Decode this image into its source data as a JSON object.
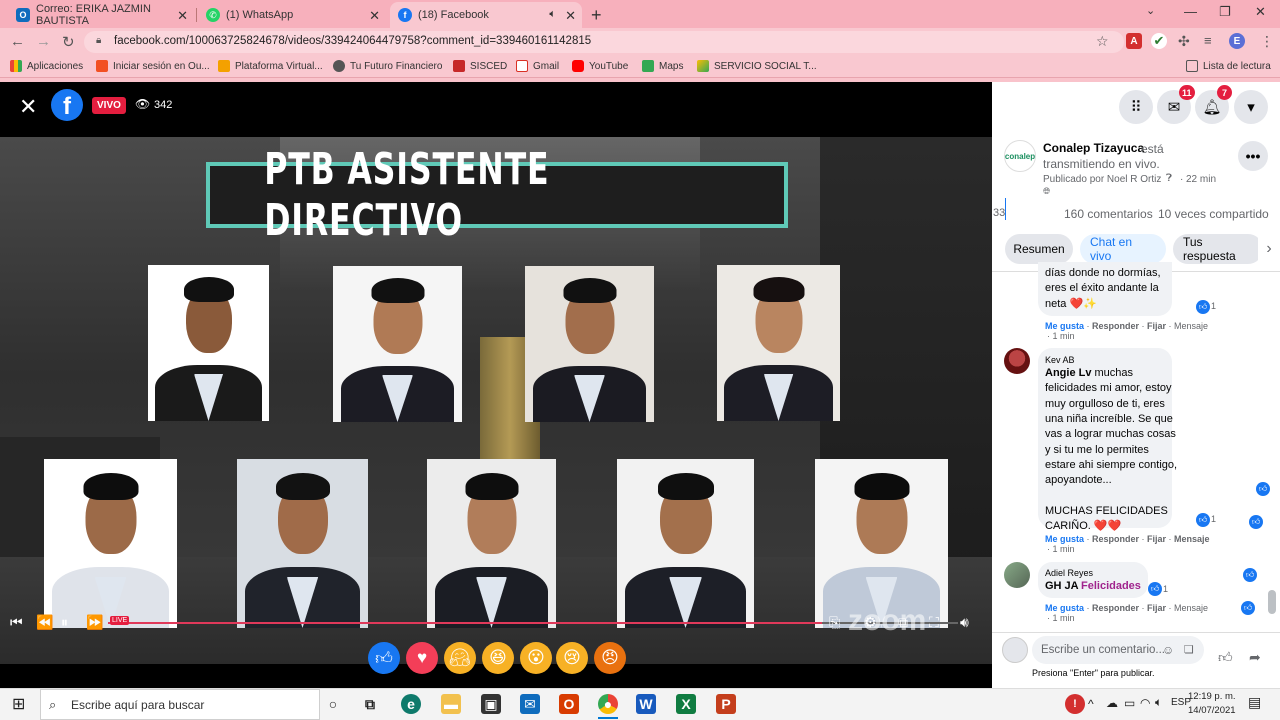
{
  "browser": {
    "tabs": [
      {
        "title": "Correo: ERIKA JAZMIN BAUTISTA",
        "icon": "outlook-icon"
      },
      {
        "title": "(1) WhatsApp",
        "icon": "whatsapp-icon"
      },
      {
        "title": "(18) Facebook",
        "icon": "facebook-icon",
        "active": true
      }
    ],
    "url": "facebook.com/100063725824678/videos/339424064479758?comment_id=339460161142815",
    "bookmarks": [
      "Aplicaciones",
      "Iniciar sesión en Ou...",
      "Plataforma Virtual...",
      "Tu Futuro Financiero",
      "SISCED",
      "Gmail",
      "YouTube",
      "Maps",
      "SERVICIO SOCIAL T..."
    ],
    "reading_list": "Lista de lectura",
    "profile_initial": "E"
  },
  "video": {
    "live_label": "VIVO",
    "viewers": "342",
    "title": "PTB ASISTENTE DIRECTIVO",
    "live_tag": "LIVE",
    "watermark": "zoom",
    "progress_fraction": 0.84
  },
  "reactions": [
    "like",
    "love",
    "care",
    "haha",
    "wow",
    "sad",
    "angry"
  ],
  "header": {
    "messenger_badge": "11",
    "notifications_badge": "7"
  },
  "post": {
    "page_name": "Conalep Tizayuca",
    "status": "está transmitiendo en vivo.",
    "status_line1": "está",
    "status_line2": "transmitiendo en vivo.",
    "published_by": "Publicado por Noel R Ortiz",
    "time": "22 min",
    "left_cut": "33",
    "comments_count": "160 comentarios",
    "shares_count": "10 veces compartido",
    "avatar_text": "conalep"
  },
  "tabs": [
    {
      "label": "Resumen"
    },
    {
      "label": "Chat en vivo",
      "selected": true
    },
    {
      "label": "Tus respuesta"
    }
  ],
  "comments": [
    {
      "author": "",
      "lines": [
        "días donde no dormías,",
        "eres el éxito andante la",
        "neta ❤️✨"
      ],
      "likes": "1",
      "actions": [
        "Me gusta",
        "Responder",
        "Fijar",
        "Mensaje"
      ],
      "time": "1 min"
    },
    {
      "author": "Kev AB",
      "lines": [
        "Angie Lv muchas",
        "felicidades mi amor, estoy",
        "muy orgulloso de ti, eres",
        "una niña increíble. Se que",
        "vas a lograr muchas cosas",
        "y si tu me lo permites",
        "estare ahi siempre contigo,",
        "apoyandote...",
        "",
        "MUCHAS FELICIDADES",
        "CARIÑO. ❤️❤️"
      ],
      "likes": "1",
      "actions": [
        "Me gusta",
        "Responder",
        "Fijar",
        "Mensaje"
      ],
      "time": "1 min"
    },
    {
      "author": "Adiel Reyes",
      "mention": "GH JA",
      "text": "Felicidades",
      "likes": "1",
      "actions": [
        "Me gusta",
        "Responder",
        "Fijar",
        "Mensaje"
      ],
      "time": "1 min"
    }
  ],
  "composer": {
    "placeholder": "Escribe un comentario...",
    "hint": "Presiona \"Enter\" para publicar."
  },
  "taskbar": {
    "search_placeholder": "Escribe aquí para buscar",
    "time": "12:19 p. m.",
    "date": "14/07/2021"
  },
  "colors": {
    "browser_chrome": "#f7b0bc",
    "facebook_blue": "#1877f2",
    "live_red": "#e41e3f",
    "title_border": "#5fc9b7"
  }
}
